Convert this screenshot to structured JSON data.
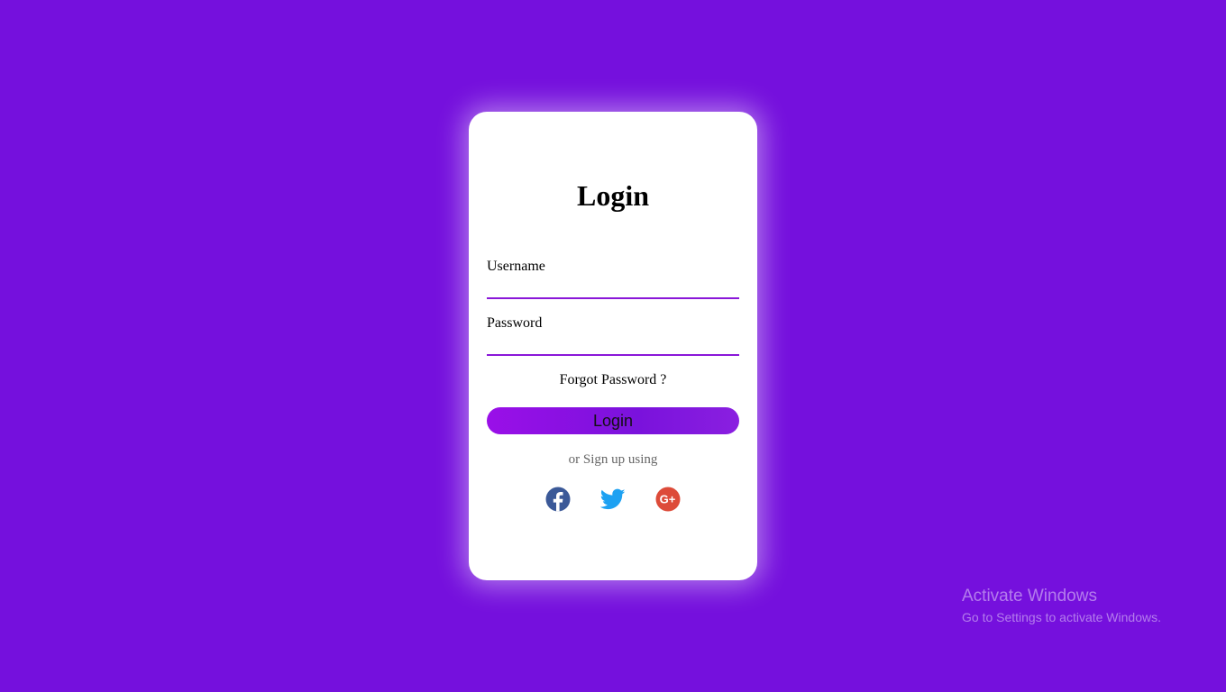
{
  "colors": {
    "background": "#7510dd",
    "card": "#ffffff",
    "accent": "#8a17d8",
    "facebook": "#3b5998",
    "twitter": "#1da1f2",
    "google": "#dd4b39"
  },
  "login_card": {
    "title": "Login",
    "username": {
      "label": "Username",
      "value": ""
    },
    "password": {
      "label": "Password",
      "value": ""
    },
    "forgot_password": "Forgot Password ?",
    "login_button": "Login",
    "signup_text": "or Sign up using",
    "socials": [
      {
        "name": "facebook",
        "icon": "facebook-icon"
      },
      {
        "name": "twitter",
        "icon": "twitter-icon"
      },
      {
        "name": "google-plus",
        "icon": "google-plus-icon"
      }
    ]
  },
  "watermark": {
    "title": "Activate Windows",
    "subtitle": "Go to Settings to activate Windows."
  }
}
